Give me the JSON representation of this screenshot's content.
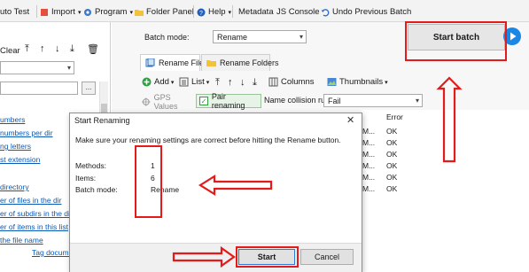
{
  "menu": {
    "auto_test": "uto Test",
    "import": "Import",
    "program": "Program",
    "folder_panel": "Folder Panel",
    "help": "Help",
    "metadata": "Metadata",
    "js_console": "JS Console",
    "undo": "Undo Previous Batch"
  },
  "left": {
    "clear": "Clear",
    "links": [
      "umbers",
      "numbers per dir",
      "ng letters",
      "st extension",
      "directory",
      "er of files in the dir",
      "er of subdirs in the dir",
      "er of items in this list",
      "the file name",
      "Tag documen"
    ]
  },
  "right": {
    "batch_mode_label": "Batch mode:",
    "batch_mode_value": "Rename",
    "start_batch": "Start batch",
    "tabs": [
      "Rename Files",
      "Rename Folders"
    ],
    "toolbar": {
      "add": "Add",
      "list": "List",
      "columns": "Columns",
      "thumbnails": "Thumbnails"
    },
    "gps_values": "GPS Values",
    "pair_renaming": "Pair renaming",
    "name_collision_label": "Name collision rule:",
    "name_collision_value": "Fail",
    "error_header": "Error",
    "rows": [
      {
        "prefix": "M...",
        "error": "OK"
      },
      {
        "prefix": "M...",
        "error": "OK"
      },
      {
        "prefix": "M...",
        "error": "OK"
      },
      {
        "prefix": "M...",
        "error": "OK"
      },
      {
        "prefix": "M...",
        "error": "OK"
      },
      {
        "prefix": "M...",
        "error": "OK"
      }
    ]
  },
  "dialog": {
    "title": "Start Renaming",
    "close": "✕",
    "message": "Make sure your renaming settings are correct before hitting the Rename button.",
    "methods_label": "Methods:",
    "methods_value": "1",
    "items_label": "Items:",
    "items_value": "6",
    "batch_mode_label": "Batch mode:",
    "batch_mode_value": "Rename",
    "start": "Start",
    "cancel": "Cancel"
  },
  "colors": {
    "annotation_red": "#e31b1b",
    "accent_blue": "#1c86e4",
    "link_blue": "#0a59b8"
  }
}
